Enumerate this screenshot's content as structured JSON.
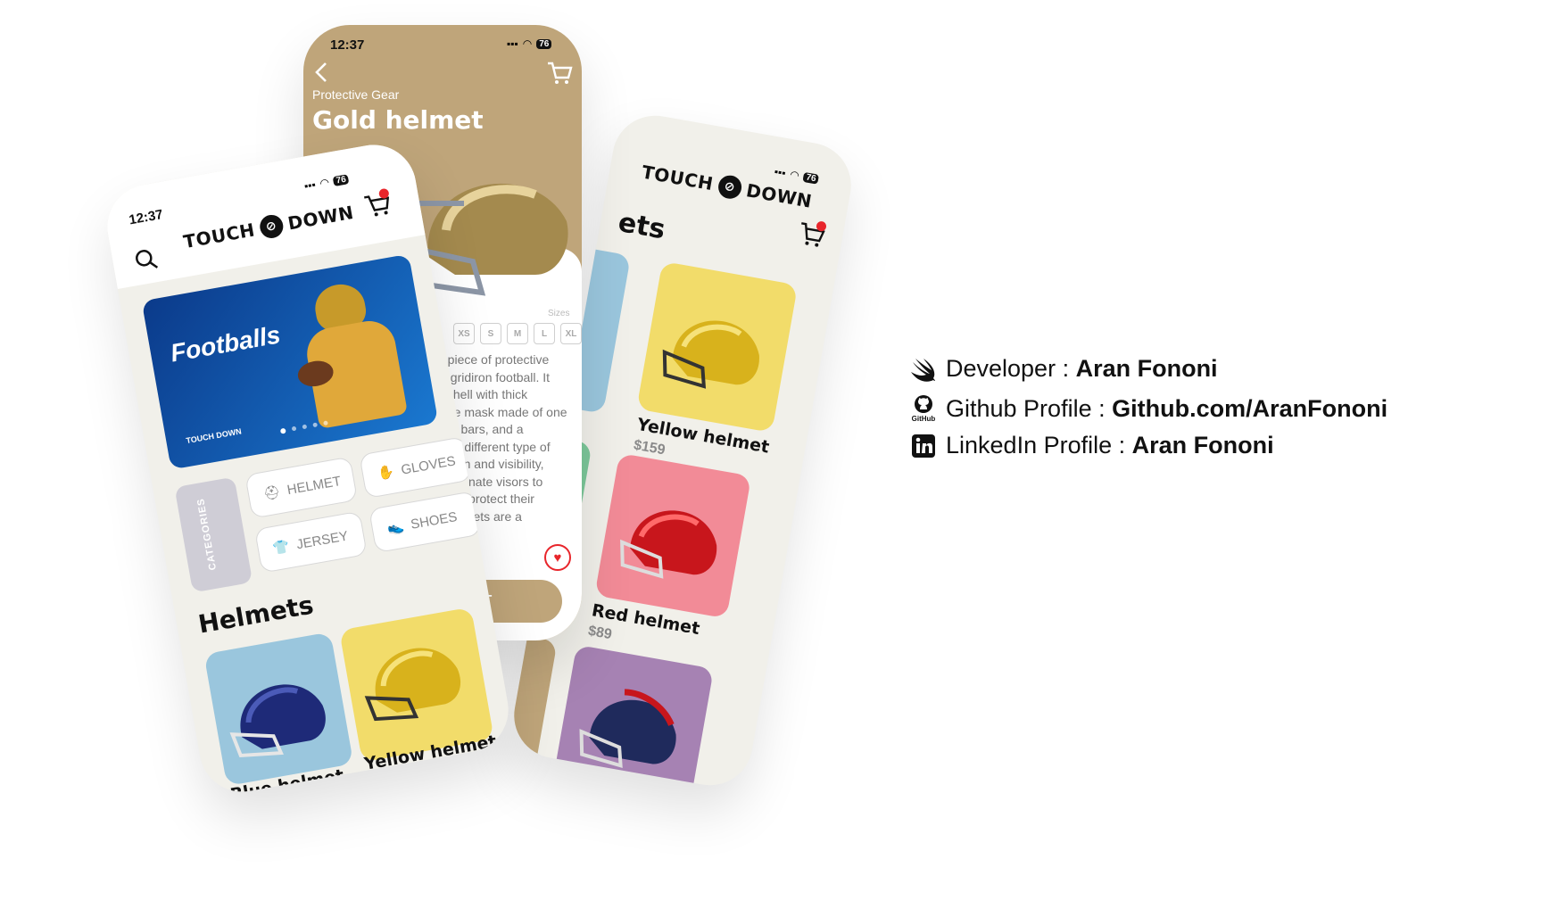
{
  "status": {
    "time": "12:37",
    "battery": "76"
  },
  "brand": {
    "left": "TOUCH",
    "right": "DOWN",
    "small": "TOUCH DOWN"
  },
  "detail": {
    "category": "Protective Gear",
    "title": "Gold helmet",
    "sizes_label": "Sizes",
    "sizes": [
      "XS",
      "S",
      "M",
      "L",
      "XL"
    ],
    "description_lines": [
      "n piece of protective",
      "in gridiron football. It",
      "c shell with thick",
      "face mask made of one",
      "etal bars, and a",
      "as a different type of",
      "ection and visibility,",
      "carbonate visors to",
      "ed to protect their",
      ". Helmets are a"
    ],
    "add_button_fragment": "RT"
  },
  "home": {
    "banner_title": "Footballs",
    "banner_brand": "TOUCH DOWN",
    "categories_label": "CATEGORIES",
    "categories": [
      "HELMET",
      "GLOVES",
      "JERSEY",
      "SHOES"
    ],
    "section_title": "Helmets",
    "products": [
      {
        "name": "Blue helmet",
        "color": "#1e2a78",
        "bg": "#9ac6dd"
      },
      {
        "name": "Yellow helmet",
        "color": "#d8b21c",
        "bg": "#f2dc6a"
      }
    ]
  },
  "list": {
    "section_title_fragment": "ets",
    "products": [
      {
        "name": "Yellow helmet",
        "price": "$159",
        "color": "#d8b21c",
        "bg": "#f2dc6a"
      },
      {
        "name": "Red helmet",
        "price": "$89",
        "color": "#c8161c",
        "bg": "#f28b97"
      }
    ]
  },
  "info": {
    "developer_label": "Developer : ",
    "developer_value": "Aran Fononi",
    "github_label": "Github Profile : ",
    "github_value": "Github.com/AranFononi",
    "github_icon_caption": "GitHub",
    "linkedin_label": "LinkedIn Profile : ",
    "linkedin_value": "Aran Fononi"
  },
  "colors": {
    "gold": "#bfa57a",
    "bg_light": "#f1f0ea",
    "accent_red": "#e8252b"
  }
}
